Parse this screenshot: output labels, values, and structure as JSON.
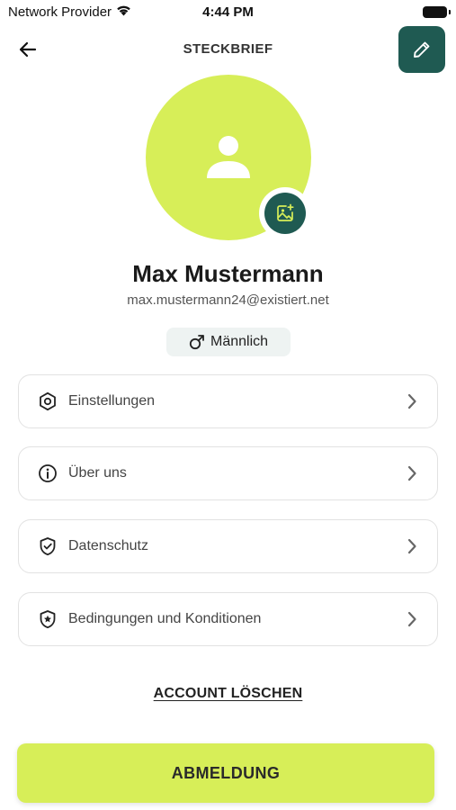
{
  "status_bar": {
    "carrier": "Network Provider",
    "time": "4:44 PM",
    "icons": [
      "wifi-icon",
      "battery-icon"
    ]
  },
  "header": {
    "title": "STECKBRIEF",
    "back_icon": "arrow-left-icon",
    "edit_icon": "pencil-icon"
  },
  "profile": {
    "avatar_icon": "user-icon",
    "avatar_edit_icon": "image-plus-icon",
    "name": "Max Mustermann",
    "email": "max.mustermann24@existiert.net",
    "gender_icon": "male-symbol-icon",
    "gender": "Männlich"
  },
  "menu": {
    "items": [
      {
        "label": "Einstellungen",
        "icon": "hexagon-settings-icon"
      },
      {
        "label": "Über uns",
        "icon": "info-icon"
      },
      {
        "label": "Datenschutz",
        "icon": "shield-check-icon"
      },
      {
        "label": "Bedingungen und Konditionen",
        "icon": "shield-star-icon"
      }
    ],
    "chevron_icon": "chevron-right-icon"
  },
  "actions": {
    "delete_account": "ACCOUNT LÖSCHEN",
    "logout": "ABMELDUNG"
  },
  "colors": {
    "accent_lime": "#d7ee58",
    "accent_dark_green": "#1f5a52",
    "card_border": "#e2e2e2",
    "badge_bg": "#eef3f2"
  }
}
